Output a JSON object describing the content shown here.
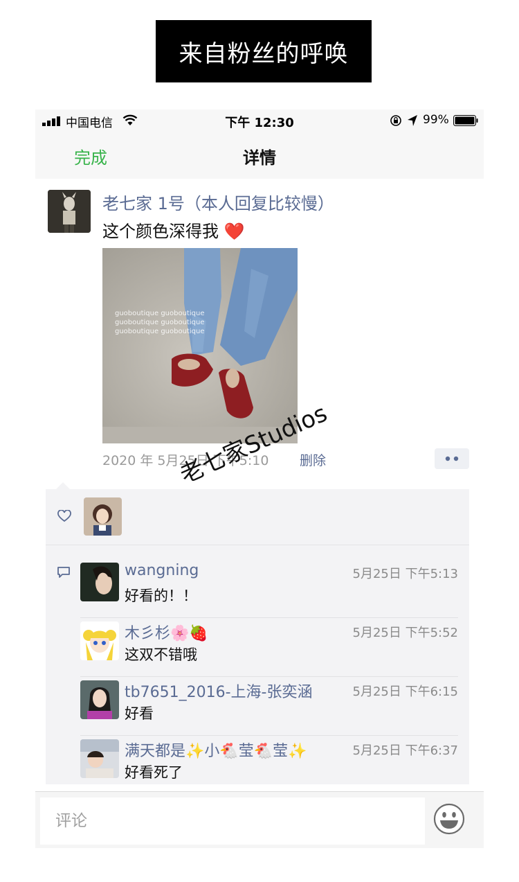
{
  "banner": {
    "text": "来自粉丝的呼唤"
  },
  "status_bar": {
    "carrier": "中国电信",
    "time": "下午 12:30",
    "battery": "99%"
  },
  "nav": {
    "done": "完成",
    "title": "详情"
  },
  "post": {
    "author": "老七家 1号（本人回复比较慢）",
    "text": "这个颜色深得我 ❤️",
    "photo_watermark": [
      "guoboutique guoboutique",
      "guoboutique guoboutique",
      "guoboutique guoboutique"
    ],
    "time": "2020 年 5月25日 下午5:10",
    "delete": "删除",
    "more": "••"
  },
  "watermark": "老七家Studios",
  "comments": [
    {
      "name": "wangning",
      "time": "5月25日 下午5:13",
      "text": "好看的！！"
    },
    {
      "name": "木彡杉🌸🍓",
      "time": "5月25日 下午5:52",
      "text": "这双不错哦"
    },
    {
      "name": "tb7651_2016-上海-张奕涵",
      "time": "5月25日 下午6:15",
      "text": "好看"
    },
    {
      "name": "满天都是✨小🐔莹🐔莹✨",
      "time": "5月25日 下午6:37",
      "text": "好看死了"
    }
  ],
  "input": {
    "placeholder": "评论"
  },
  "colors": {
    "link": "#5a6b93",
    "done": "#37b34a",
    "comment_bg": "#f3f3f5"
  }
}
